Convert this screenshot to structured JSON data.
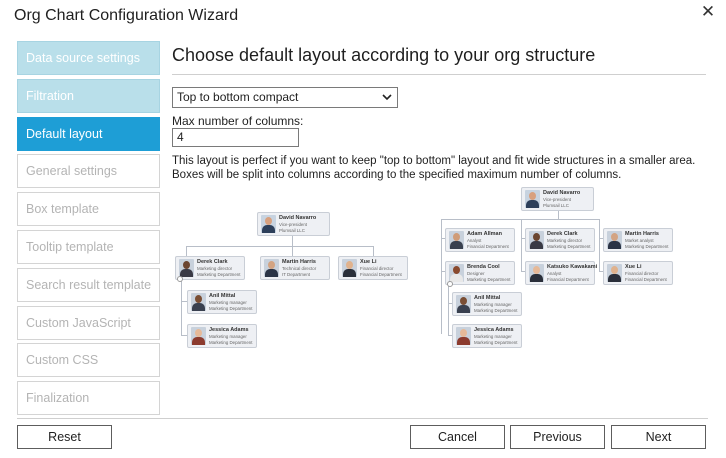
{
  "window": {
    "title": "Org Chart Configuration Wizard",
    "close_glyph": "✕"
  },
  "sidebar": {
    "items": [
      {
        "label": "Data source settings",
        "state": "done"
      },
      {
        "label": "Filtration",
        "state": "done"
      },
      {
        "label": "Default layout",
        "state": "active"
      },
      {
        "label": "General settings",
        "state": "disabled"
      },
      {
        "label": "Box template",
        "state": "disabled"
      },
      {
        "label": "Tooltip template",
        "state": "disabled"
      },
      {
        "label": "Search result template",
        "state": "disabled"
      },
      {
        "label": "Custom JavaScript",
        "state": "disabled"
      },
      {
        "label": "Custom CSS",
        "state": "disabled"
      },
      {
        "label": "Finalization",
        "state": "disabled"
      }
    ]
  },
  "main": {
    "heading": "Choose default layout according to your org structure",
    "layout_select": {
      "value": "Top to bottom compact"
    },
    "columns": {
      "label": "Max number of columns:",
      "value": "4"
    },
    "description_line1": "This layout is perfect if you want to keep \"top to bottom\" layout and fit wide structures in a smaller area.",
    "description_line2": "Boxes will be split into columns according to the specified maximum number of columns."
  },
  "preview": {
    "people": {
      "david": {
        "name": "David Navarro",
        "line1": "Vice-president",
        "line2": "Plumsail LLC"
      },
      "derek": {
        "name": "Derek Clark",
        "line1": "Marketing director",
        "line2": "Marketing Department"
      },
      "martin_tech": {
        "name": "Martin Harris",
        "line1": "Technical director",
        "line2": "IT Department"
      },
      "xue": {
        "name": "Xue Li",
        "line1": "Financial director",
        "line2": "Financial Department"
      },
      "anil": {
        "name": "Anil Mittal",
        "line1": "Marketing manager",
        "line2": "Marketing Department"
      },
      "jessica": {
        "name": "Jessica Adams",
        "line1": "Marketing manager",
        "line2": "Marketing Department"
      },
      "adam": {
        "name": "Adam Allman",
        "line1": "Analyst",
        "line2": "Financial Department"
      },
      "martin_mkt": {
        "name": "Martin Harris",
        "line1": "Market analyst",
        "line2": "Marketing Department"
      },
      "brenda": {
        "name": "Brenda Cool",
        "line1": "Designer",
        "line2": "Marketing Department"
      },
      "katsuko": {
        "name": "Katsuko Kawakami",
        "line1": "Analyst",
        "line2": "Financial Department"
      }
    }
  },
  "footer": {
    "reset": "Reset",
    "cancel": "Cancel",
    "previous": "Previous",
    "next": "Next"
  },
  "colors": {
    "accent": "#1e9ed6",
    "done_step": "#b9dfea",
    "disabled_text": "#b4b4b4"
  }
}
